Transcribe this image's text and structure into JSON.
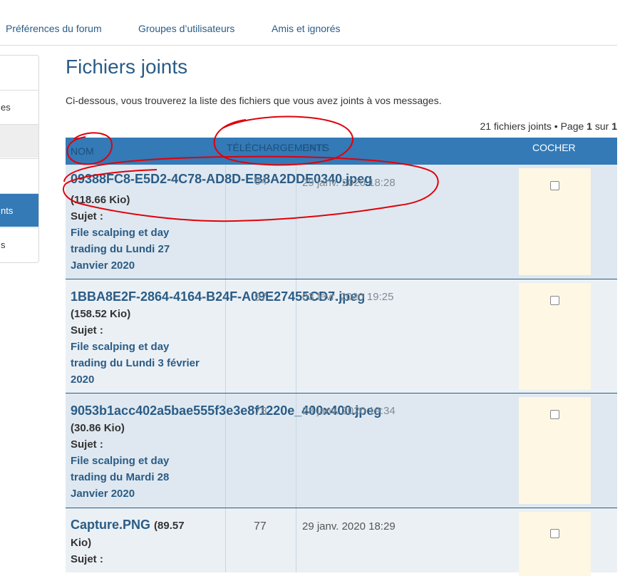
{
  "top_tabs": [
    "Préférences du forum",
    "Groupes d’utilisateurs",
    "Amis et ignorés"
  ],
  "left_nav": {
    "items": [
      {
        "label": ""
      },
      {
        "label": "es"
      },
      {
        "label": ""
      },
      {
        "label": ""
      },
      {
        "label": "nts"
      },
      {
        "label": "s"
      }
    ]
  },
  "main": {
    "title": "Fichiers joints",
    "intro": "Ci-dessous, vous trouverez la liste des fichiers que vous avez joints à vos messages.",
    "pagination": {
      "count_text": "21 fichiers joints • Page ",
      "current_page": "1",
      "of_text": " sur ",
      "total_pages": "1"
    }
  },
  "table": {
    "headers": {
      "name": "NOM",
      "downloads": "TÉLÉCHARGEMENTS",
      "date": "DATE",
      "mark": "COCHER"
    },
    "rows": [
      {
        "filename": "09388FC8-E5D2-4C78-AD8D-EB8A2DDE0340.jpeg",
        "size": "(118.66 Kio)",
        "sujet_label": "Sujet :",
        "subject_lines": [
          "File scalping et day",
          "trading du Lundi 27",
          "Janvier 2020"
        ],
        "downloads": "84",
        "date": "29 janv. 2020 18:28"
      },
      {
        "filename": "1BBA8E2F-2864-4164-B24F-A09E27455CD7.jpeg",
        "size": "(158.52 Kio)",
        "sujet_label": "Sujet :",
        "subject_lines": [
          "File scalping et day",
          "trading du Lundi 3 février",
          "2020"
        ],
        "downloads": "97",
        "date": "03 févr. 2020 19:25"
      },
      {
        "filename": "9053b1acc402a5bae555f3e3e8f1220e_400x400.jpeg",
        "size": "(30.86 Kio)",
        "sujet_label": "Sujet :",
        "subject_lines": [
          "File scalping et day",
          "trading du Mardi 28",
          "Janvier 2020"
        ],
        "downloads": "78",
        "date": "28 janv. 2020 19:34"
      },
      {
        "filename": "Capture.PNG",
        "size": "(89.57",
        "size_cont": "Kio)",
        "sujet_label": "Sujet :",
        "subject_lines": [],
        "downloads": "77",
        "date": "29 janv. 2020 18:29"
      }
    ]
  },
  "colors": {
    "header_bg": "#337ab7",
    "link": "#2a5c86",
    "row_a": "#dfe8f0",
    "row_b": "#ebf0f5",
    "mark_bg": "#fdf7e4",
    "annotation": "#e0000b"
  }
}
